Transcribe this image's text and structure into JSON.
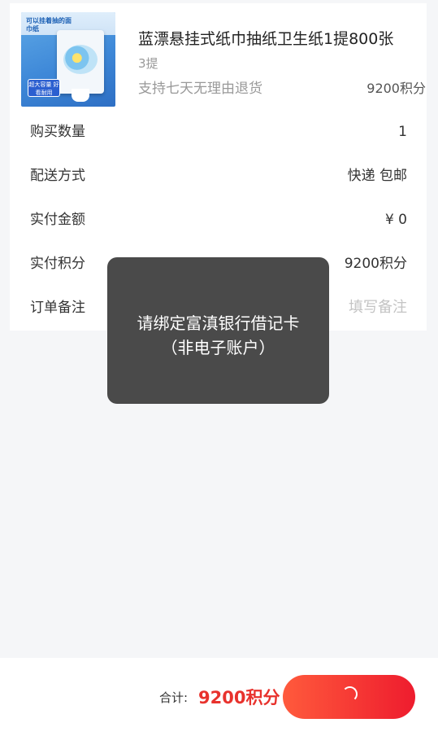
{
  "product": {
    "image_caption_top": "可以挂着抽的面巾纸",
    "image_badge": "超大容量 好看耐用",
    "title": "蓝漂悬挂式纸巾抽纸卫生纸1提800张",
    "spec": "3提",
    "return_policy": "支持七天无理由退货",
    "points": "9200积分"
  },
  "order": {
    "quantity": {
      "label": "购买数量",
      "value": "1"
    },
    "delivery": {
      "label": "配送方式",
      "value": "快递 包邮"
    },
    "amount": {
      "label": "实付金额",
      "value": "¥ 0"
    },
    "points": {
      "label": "实付积分",
      "value": "9200积分"
    },
    "remark": {
      "label": "订单备注",
      "placeholder": "填写备注"
    }
  },
  "toast": {
    "line1": "请绑定富滇银行借记卡",
    "line2": "（非电子账户）"
  },
  "footer": {
    "total_label": "合计:",
    "total_value": "9200积分",
    "submit_state": "loading"
  },
  "colors": {
    "accent": "#e8322d",
    "button_start": "#ff5a3c",
    "button_end": "#ee1c2e",
    "toast_bg": "#4a4a4a"
  }
}
